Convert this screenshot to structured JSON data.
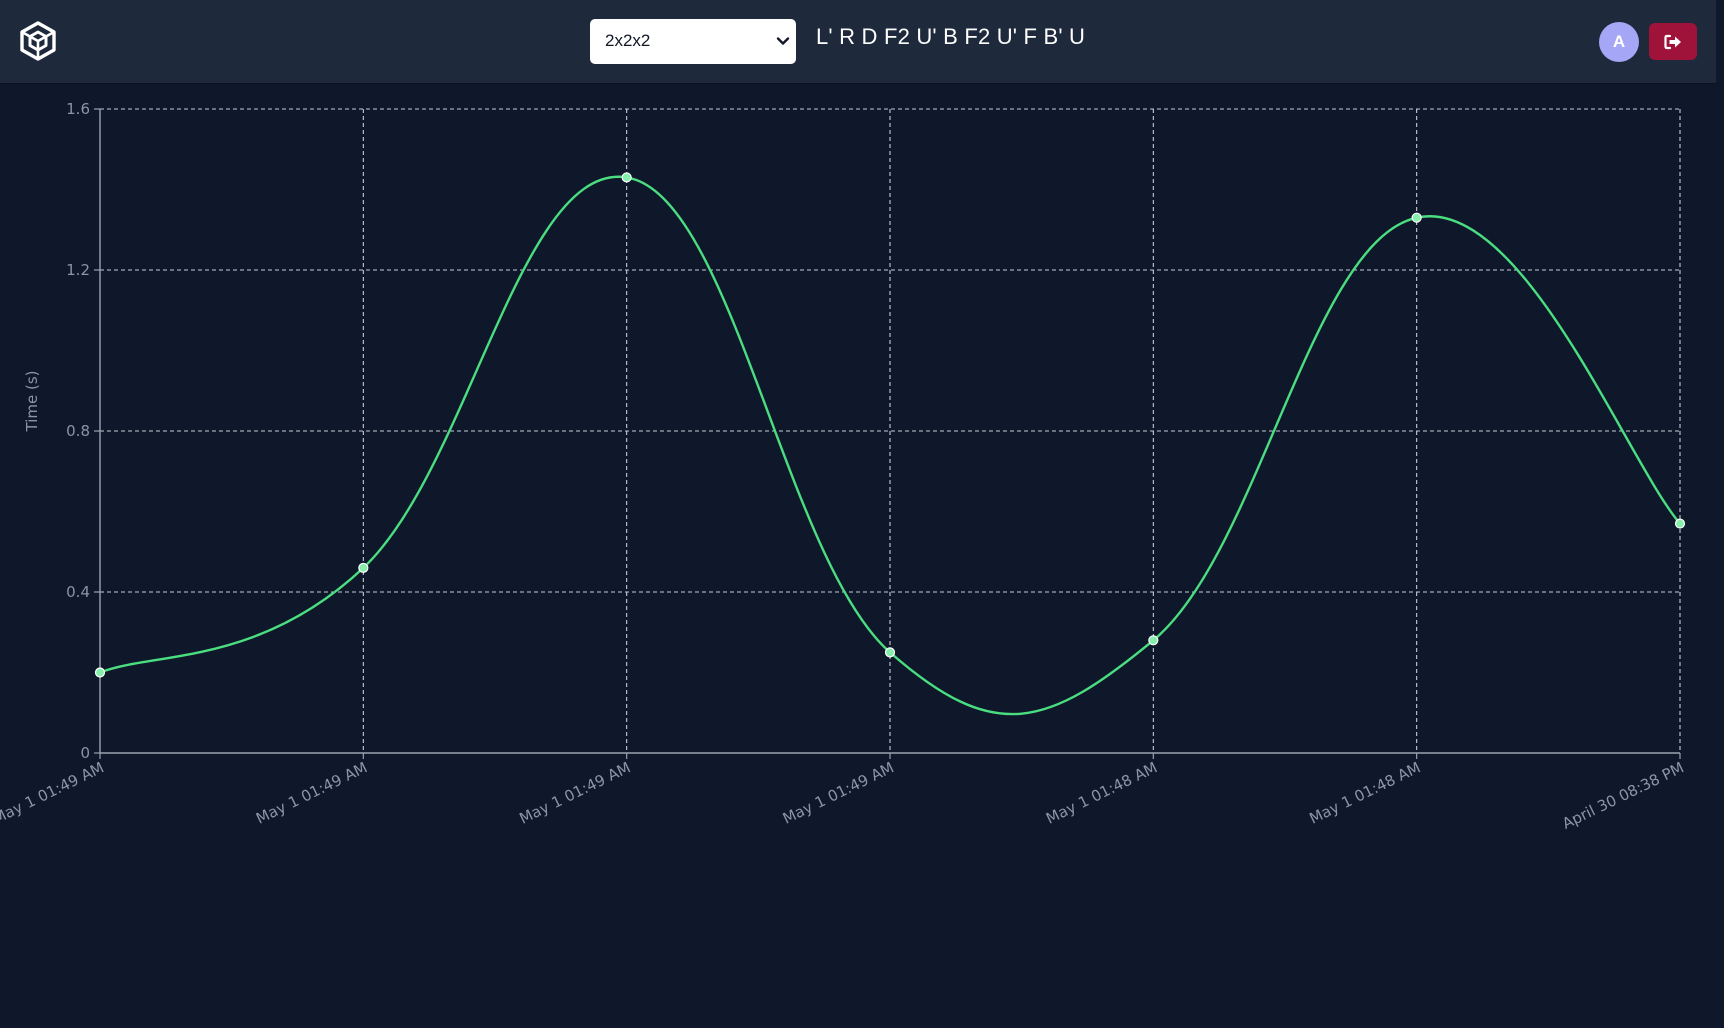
{
  "header": {
    "logo_icon": "cube-logo-icon",
    "puzzle_select": {
      "selected": "2x2x2"
    },
    "scramble": "L' R D F2 U' B F2 U' F B' U",
    "avatar_initial": "A",
    "logout_icon": "sign-out-icon"
  },
  "colors": {
    "background": "#0f172a",
    "header": "#1e293b",
    "line": "#4ade80",
    "avatar": "#a5a6f6",
    "logout": "#9f1239"
  },
  "chart_data": {
    "type": "line",
    "title": "",
    "xlabel": "",
    "ylabel": "Time (s)",
    "ylim": [
      0,
      1.6
    ],
    "yticks": [
      "0",
      "0.4",
      "0.8",
      "1.2",
      "1.6"
    ],
    "grid": true,
    "smooth": true,
    "categories": [
      "May 1 01:49 AM",
      "May 1 01:49 AM",
      "May 1 01:49 AM",
      "May 1 01:49 AM",
      "May 1 01:48 AM",
      "May 1 01:48 AM",
      "April 30 08:38 PM"
    ],
    "values": [
      0.2,
      0.46,
      1.43,
      0.25,
      0.28,
      1.33,
      0.57
    ]
  }
}
